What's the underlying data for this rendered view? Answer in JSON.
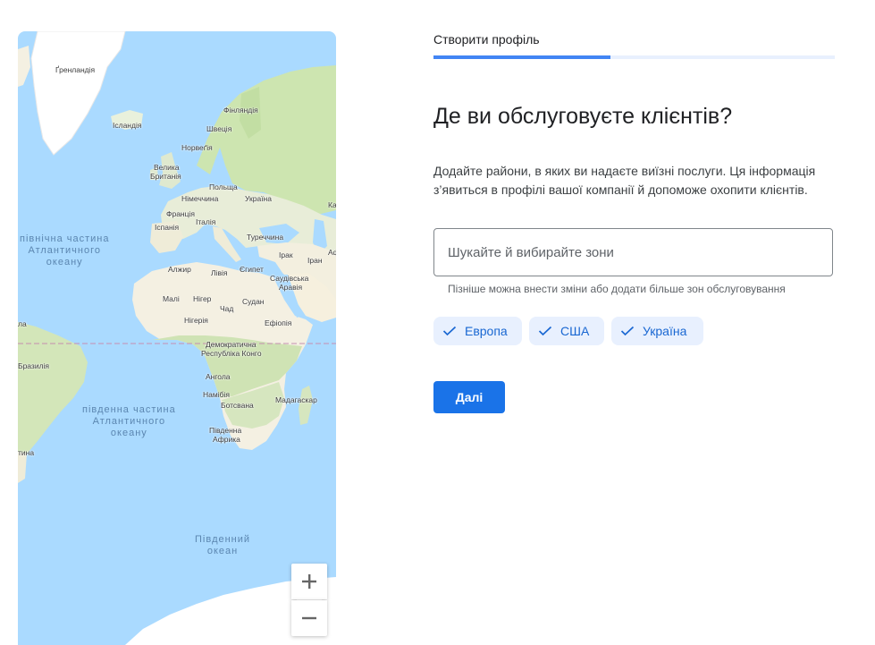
{
  "page": {
    "step_title": "Створити профіль",
    "progress": 0.44,
    "heading": "Де ви обслуговуєте клієнтів?",
    "description": "Додайте райони, в яких ви надаєте виїзні послуги. Ця інформація з’явиться в профілі вашої компанії й допоможе охопити клієнтів.",
    "search_placeholder": "Шукайте й вибирайте зони",
    "search_value": "",
    "hint": "Пізніше можна внести зміни або додати більше зон обслуговування",
    "chips": [
      "Европа",
      "США",
      "Україна"
    ],
    "next_button": "Далі"
  },
  "map": {
    "oceans": {
      "north_atlantic": [
        "північна частина",
        "Атлантичного",
        "океану"
      ],
      "south_atlantic": [
        "південна частина",
        "Атлантичного",
        "океану"
      ],
      "southern": [
        "Південний",
        "океан"
      ]
    },
    "labels": {
      "greenland": "Ґренландія",
      "iceland": "Ісландія",
      "finland": "Фінляндія",
      "norway": "Норвеґія",
      "sweden": "Швеція",
      "uk_line1": "Велика",
      "uk_line2": "Британія",
      "poland": "Польща",
      "germany": "Німеччина",
      "ukraine": "Україна",
      "france": "Франція",
      "italy": "Італія",
      "spain": "Іспанія",
      "turkey": "Туреччина",
      "iraq": "Ірак",
      "iran": "Іран",
      "algeria": "Алжир",
      "libya": "Лівія",
      "egypt": "Єгипет",
      "saudi_line1": "Саудівська",
      "saudi_line2": "Аравія",
      "mali": "Малі",
      "niger": "Нігер",
      "chad": "Чад",
      "sudan": "Судан",
      "nigeria": "Нігерія",
      "ethiopia": "Ефіопія",
      "drc_line1": "Демократична",
      "drc_line2": "Республіка Конго",
      "brazil": "Бразилія",
      "angola": "Ангола",
      "namibia": "Намібія",
      "botswana": "Ботсвана",
      "madagascar": "Мадагаскар",
      "south_africa_line1": "Південна",
      "south_africa_line2": "Африка",
      "edge_ka": "Ка",
      "edge_af": "Аф",
      "edge_la": "ла",
      "edge_tina": "тина"
    },
    "zoom_in_icon": "plus-icon",
    "zoom_out_icon": "minus-icon"
  },
  "colors": {
    "accent": "#1a73e8",
    "progress_fill": "#4285f4",
    "chip_bg": "#e8f0fe",
    "chip_text": "#1967d2",
    "ocean": "#aadaff",
    "land": "#f4f0e2",
    "forest": "#c6dfaa"
  }
}
